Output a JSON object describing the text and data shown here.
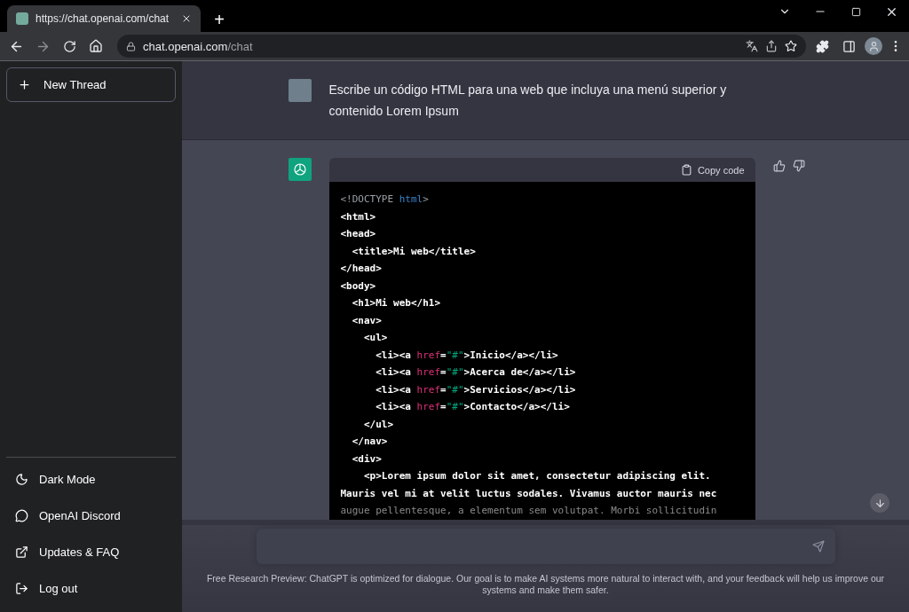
{
  "browser": {
    "tab_title": "https://chat.openai.com/chat",
    "new_tab": "+",
    "url_host": "chat.openai.com",
    "url_path": "/chat"
  },
  "sidebar": {
    "new_thread": "New Thread",
    "items": [
      {
        "label": "Dark Mode"
      },
      {
        "label": "OpenAI Discord"
      },
      {
        "label": "Updates & FAQ"
      },
      {
        "label": "Log out"
      }
    ]
  },
  "user_message": {
    "text": "Escribe un código HTML para una web que incluya una menú superior y contenido Lorem Ipsum"
  },
  "assistant_message": {
    "copy_label": "Copy code",
    "code_lines": [
      {
        "faded": false,
        "tokens": [
          {
            "kind": "doctype",
            "text": "<!DOCTYPE "
          },
          {
            "kind": "keyword",
            "text": "html"
          },
          {
            "kind": "doctype",
            "text": ">"
          }
        ]
      },
      {
        "faded": false,
        "tokens": [
          {
            "kind": "plain",
            "text": "<html>"
          }
        ]
      },
      {
        "faded": false,
        "tokens": [
          {
            "kind": "plain",
            "text": "<head>"
          }
        ]
      },
      {
        "faded": false,
        "tokens": [
          {
            "kind": "plain",
            "text": "  <title>Mi web</title>"
          }
        ]
      },
      {
        "faded": false,
        "tokens": [
          {
            "kind": "plain",
            "text": "</head>"
          }
        ]
      },
      {
        "faded": false,
        "tokens": [
          {
            "kind": "plain",
            "text": "<body>"
          }
        ]
      },
      {
        "faded": false,
        "tokens": [
          {
            "kind": "plain",
            "text": "  <h1>Mi web</h1>"
          }
        ]
      },
      {
        "faded": false,
        "tokens": [
          {
            "kind": "plain",
            "text": "  <nav>"
          }
        ]
      },
      {
        "faded": false,
        "tokens": [
          {
            "kind": "plain",
            "text": "    <ul>"
          }
        ]
      },
      {
        "faded": false,
        "tokens": [
          {
            "kind": "plain",
            "text": "      <li><a "
          },
          {
            "kind": "attr",
            "text": "href"
          },
          {
            "kind": "plain",
            "text": "="
          },
          {
            "kind": "string",
            "text": "\"#\""
          },
          {
            "kind": "plain",
            "text": ">Inicio</a></li>"
          }
        ]
      },
      {
        "faded": false,
        "tokens": [
          {
            "kind": "plain",
            "text": "      <li><a "
          },
          {
            "kind": "attr",
            "text": "href"
          },
          {
            "kind": "plain",
            "text": "="
          },
          {
            "kind": "string",
            "text": "\"#\""
          },
          {
            "kind": "plain",
            "text": ">Acerca de</a></li>"
          }
        ]
      },
      {
        "faded": false,
        "tokens": [
          {
            "kind": "plain",
            "text": "      <li><a "
          },
          {
            "kind": "attr",
            "text": "href"
          },
          {
            "kind": "plain",
            "text": "="
          },
          {
            "kind": "string",
            "text": "\"#\""
          },
          {
            "kind": "plain",
            "text": ">Servicios</a></li>"
          }
        ]
      },
      {
        "faded": false,
        "tokens": [
          {
            "kind": "plain",
            "text": "      <li><a "
          },
          {
            "kind": "attr",
            "text": "href"
          },
          {
            "kind": "plain",
            "text": "="
          },
          {
            "kind": "string",
            "text": "\"#\""
          },
          {
            "kind": "plain",
            "text": ">Contacto</a></li>"
          }
        ]
      },
      {
        "faded": false,
        "tokens": [
          {
            "kind": "plain",
            "text": "    </ul>"
          }
        ]
      },
      {
        "faded": false,
        "tokens": [
          {
            "kind": "plain",
            "text": "  </nav>"
          }
        ]
      },
      {
        "faded": false,
        "tokens": [
          {
            "kind": "plain",
            "text": "  <div>"
          }
        ]
      },
      {
        "faded": false,
        "tokens": [
          {
            "kind": "plain",
            "text": "    <p>Lorem ipsum dolor sit amet, consectetur adipiscing elit."
          }
        ]
      },
      {
        "faded": false,
        "tokens": [
          {
            "kind": "plain",
            "text": "Mauris vel mi at velit luctus sodales. Vivamus auctor mauris nec"
          }
        ]
      },
      {
        "faded": true,
        "tokens": [
          {
            "kind": "plain",
            "text": "augue pellentesque, a elementum sem volutpat. Morbi sollicitudin"
          }
        ]
      }
    ]
  },
  "footer": {
    "text": "Free Research Preview: ChatGPT is optimized for dialogue. Our goal is to make AI systems more natural to interact with, and your feedback will help us improve our systems and make them safer."
  }
}
